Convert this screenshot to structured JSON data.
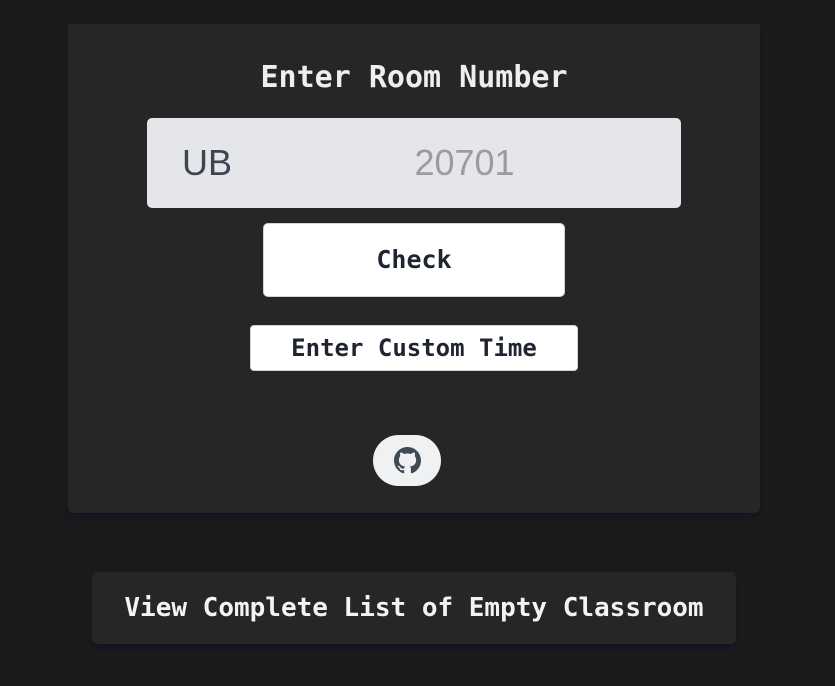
{
  "card": {
    "title": "Enter Room Number"
  },
  "room": {
    "prefix": "UB",
    "value": "",
    "placeholder": "20701"
  },
  "buttons": {
    "check_label": "Check",
    "custom_time_label": "Enter Custom Time",
    "view_list_label": "View Complete List of Empty Classroom"
  },
  "icons": {
    "github": "github-icon"
  },
  "colors": {
    "page_background": "#1b1b1b",
    "card_background": "#262626",
    "input_background": "#e5e6ea",
    "button_background": "#ffffff",
    "text_light": "#eceef2",
    "text_dark": "#1f2530"
  }
}
